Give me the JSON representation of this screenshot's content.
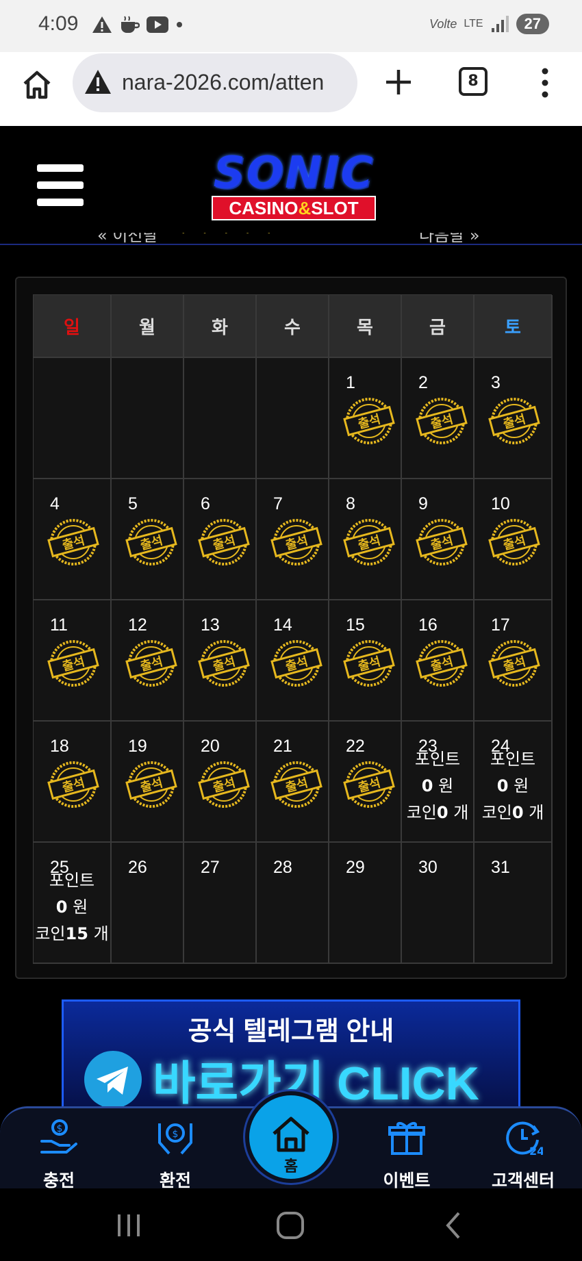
{
  "status_bar": {
    "time": "4:09",
    "network": "LTE",
    "volte": "Volte",
    "battery": "27"
  },
  "browser": {
    "url": "nara-2026.com/atten",
    "tab_count": "8"
  },
  "header": {
    "logo_title": "SONIC",
    "logo_sub_left": "CASINO",
    "logo_sub_amp": "&",
    "logo_sub_right": "SLOT"
  },
  "month_nav": {
    "prev": "« 이전달",
    "next": "다음달 »"
  },
  "calendar": {
    "weekdays": [
      "일",
      "월",
      "화",
      "수",
      "목",
      "금",
      "토"
    ],
    "stamp_text": "출석",
    "weeks": [
      [
        null,
        null,
        null,
        null,
        {
          "day": "1",
          "stamp": true
        },
        {
          "day": "2",
          "stamp": true
        },
        {
          "day": "3",
          "stamp": true
        }
      ],
      [
        {
          "day": "4",
          "stamp": true
        },
        {
          "day": "5",
          "stamp": true
        },
        {
          "day": "6",
          "stamp": true
        },
        {
          "day": "7",
          "stamp": true
        },
        {
          "day": "8",
          "stamp": true
        },
        {
          "day": "9",
          "stamp": true
        },
        {
          "day": "10",
          "stamp": true
        }
      ],
      [
        {
          "day": "11",
          "stamp": true
        },
        {
          "day": "12",
          "stamp": true
        },
        {
          "day": "13",
          "stamp": true
        },
        {
          "day": "14",
          "stamp": true
        },
        {
          "day": "15",
          "stamp": true
        },
        {
          "day": "16",
          "stamp": true
        },
        {
          "day": "17",
          "stamp": true
        }
      ],
      [
        {
          "day": "18",
          "stamp": true
        },
        {
          "day": "19",
          "stamp": true
        },
        {
          "day": "20",
          "stamp": true
        },
        {
          "day": "21",
          "stamp": true
        },
        {
          "day": "22",
          "stamp": true
        },
        {
          "day": "23",
          "reward": {
            "points_label": "포인트",
            "points": "0",
            "points_unit": "원",
            "coin_label": "코인",
            "coins": "0",
            "coin_unit": "개"
          }
        },
        {
          "day": "24",
          "reward": {
            "points_label": "포인트",
            "points": "0",
            "points_unit": "원",
            "coin_label": "코인",
            "coins": "0",
            "coin_unit": "개"
          }
        }
      ],
      [
        {
          "day": "25",
          "reward": {
            "points_label": "포인트",
            "points": "0",
            "points_unit": "원",
            "coin_label": "코인",
            "coins": "15",
            "coin_unit": "개"
          }
        },
        {
          "day": "26"
        },
        {
          "day": "27"
        },
        {
          "day": "28"
        },
        {
          "day": "29"
        },
        {
          "day": "30"
        },
        {
          "day": "31"
        }
      ]
    ]
  },
  "banner": {
    "title": "공식 텔레그램 안내",
    "cta": "바로가기 CLICK"
  },
  "bottom_nav": {
    "charge": "충전",
    "exchange": "환전",
    "home": "홈",
    "event": "이벤트",
    "support": "고객센터"
  },
  "colors": {
    "sunday": "#e01010",
    "saturday": "#3aa0ff",
    "stamp_gold": "#e6b81e",
    "home_button": "#0aa2e8"
  }
}
